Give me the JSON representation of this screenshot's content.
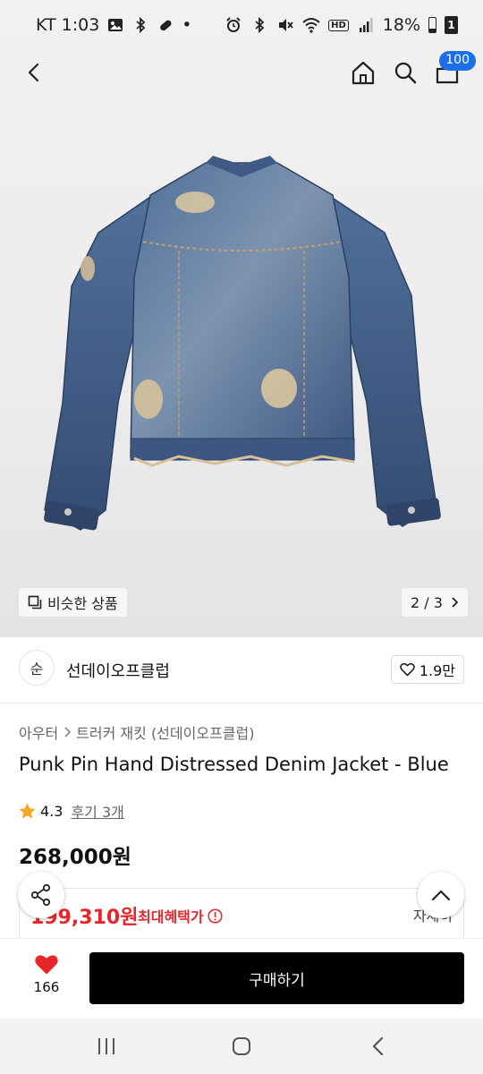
{
  "status_bar": {
    "carrier_time": "KT 1:03",
    "dot": "•",
    "battery": "18%",
    "battery_num": "1",
    "hd": "HD",
    "icons_left": [
      "gallery-icon",
      "bluetooth-icon",
      "link-icon"
    ],
    "icons_right": [
      "alarm-icon",
      "bluetooth-icon",
      "mute-icon",
      "wifi-icon",
      "hd-icon",
      "signal-icon",
      "battery-icon"
    ]
  },
  "header": {
    "cart_badge": "100",
    "icons": [
      "back-icon",
      "home-icon",
      "search-icon",
      "cart-icon"
    ]
  },
  "gallery": {
    "similar_label": "비슷한 상품",
    "page_current": 2,
    "page_total": 3,
    "page_indicator": "2 / 3"
  },
  "store": {
    "logo_text": "순",
    "name": "선데이오프클럽",
    "likes": "1.9만"
  },
  "product": {
    "breadcrumb": [
      "아우터",
      "트러커 재킷 (선데이오프클럽)"
    ],
    "title": "Punk Pin Hand Distressed Denim Jacket - Blue",
    "rating": "4.3",
    "reviews_label": "후기 3개",
    "price": "268,000원",
    "benefit_price": "199,310원",
    "benefit_label": "최대혜택가",
    "benefit_more": "자세히"
  },
  "action_bar": {
    "heart_count": "166",
    "buy_label": "구매하기"
  },
  "colors": {
    "accent_blue": "#1c6fe8",
    "sale_red": "#e8262a",
    "heart_red": "#e8262a",
    "star_orange": "#f5a623",
    "buy_button": "#000000"
  }
}
